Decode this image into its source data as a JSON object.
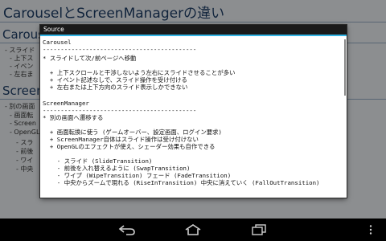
{
  "background": {
    "title": "CarouselとScreenManagerの違い",
    "section1_heading": "Carousel",
    "section1_lines": [
      "- スライド",
      "- 上下ス",
      "- イベン",
      "- 左右ま"
    ],
    "section2_heading": "ScreenManager",
    "section2_lines": [
      "- 別の画面",
      "- 画面転",
      "- Screen",
      "- OpenGL",
      "- スラ",
      "- 前後",
      "- ワイ",
      "- 中央"
    ]
  },
  "dialog": {
    "title": "Source",
    "lines": [
      "Carousel",
      "-------------------------------------------",
      "* スライドして次/前ページへ移動",
      "",
      "  + 上下スクロールと干渉しないよう左右にスライドさせることが多い",
      "  + イベント記述なしで、スライド操作を受け付ける",
      "  + 左右または上下方向のスライド表示しかできない",
      "",
      "",
      "ScreenManager",
      "-------------------------------------------",
      "* 別の画面へ遷移する",
      "",
      "  + 画面転換に使う (ゲームオーバー、設定画面、ログイン要求)",
      "  + ScreenManager自体はスライド操作は受け付けない",
      "  + OpenGLのエフェクトが使え、シェーダー効果も自作できる",
      "",
      "    - スライド (SlideTransition)",
      "    - 前後を入れ替えるように (SwapTransition)",
      "    - ワイプ (WipeTransition) フェード (FadeTransition)",
      "    - 中央からズームで現れる (RiseInTransition) 中央に消えていく (FallOutTransition)"
    ]
  },
  "navbar": {
    "back_icon": "back-arrow-icon",
    "home_icon": "home-icon",
    "recents_icon": "recent-apps-icon",
    "menu_icon": "overflow-menu-icon"
  },
  "colors": {
    "accent": "#33b5e5",
    "heading": "#1e3e68"
  }
}
